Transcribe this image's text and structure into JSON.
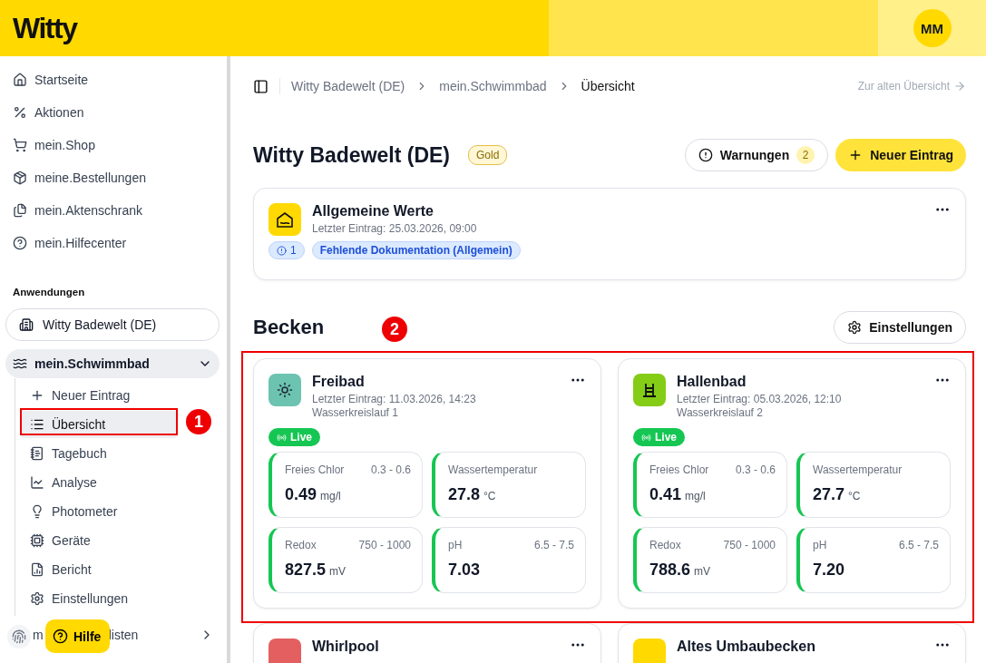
{
  "header": {
    "logo": "Witty",
    "avatar": "MM"
  },
  "sidebar": {
    "items": [
      {
        "label": "Startseite"
      },
      {
        "label": "Aktionen"
      },
      {
        "label": "mein.Shop"
      },
      {
        "label": "meine.Bestellungen"
      },
      {
        "label": "mein.Aktenschrank"
      },
      {
        "label": "mein.Hilfecenter"
      }
    ],
    "section_title": "Anwendungen",
    "app": {
      "label": "Witty Badewelt (DE)"
    },
    "group": {
      "label": "mein.Schwimmbad",
      "expanded": true,
      "children": [
        {
          "label": "Neuer Eintrag",
          "selected": false
        },
        {
          "label": "Übersicht",
          "selected": true
        },
        {
          "label": "Tagebuch",
          "selected": false
        },
        {
          "label": "Analyse",
          "selected": false
        },
        {
          "label": "Photometer",
          "selected": false
        },
        {
          "label": "Geräte",
          "selected": false
        },
        {
          "label": "Bericht",
          "selected": false
        },
        {
          "label": "Einstellungen",
          "selected": false
        }
      ]
    },
    "partial_item": {
      "parts": [
        "m",
        "listen"
      ]
    },
    "help_button": "Hilfe"
  },
  "breadcrumb": [
    "Witty Badewelt (DE)",
    "mein.Schwimmbad",
    "Übersicht"
  ],
  "old_overview_link": "Zur alten Übersicht",
  "page": {
    "title": "Witty Badewelt (DE)",
    "badge": "Gold",
    "warnings": {
      "label": "Warnungen",
      "count": "2"
    },
    "new_entry": "Neuer Eintrag"
  },
  "general_card": {
    "title": "Allgemeine Werte",
    "last_entry": "Letzter Eintrag: 25.03.2026, 09:00",
    "count": "1",
    "tag": "Fehlende Dokumentation (Allgemein)"
  },
  "pools_section": {
    "title": "Becken",
    "settings": "Einstellungen"
  },
  "pools": [
    {
      "name": "Freibad",
      "color": "#6cc3b0",
      "last_entry": "Letzter Eintrag: 11.03.2026, 14:23",
      "circuit": "Wasserkreislauf 1",
      "live": "Live",
      "metrics": [
        {
          "label": "Freies Chlor",
          "range": "0.3 - 0.6",
          "value": "0.49",
          "unit": "mg/l"
        },
        {
          "label": "Wassertemperatur",
          "value": "27.8",
          "unit": "°C"
        },
        {
          "label": "Redox",
          "range": "750 - 1000",
          "value": "827.5",
          "unit": "mV"
        },
        {
          "label": "pH",
          "range": "6.5 - 7.5",
          "value": "7.03"
        }
      ]
    },
    {
      "name": "Hallenbad",
      "color": "#84cc16",
      "last_entry": "Letzter Eintrag: 05.03.2026, 12:10",
      "circuit": "Wasserkreislauf 2",
      "live": "Live",
      "metrics": [
        {
          "label": "Freies Chlor",
          "range": "0.3 - 0.6",
          "value": "0.41",
          "unit": "mg/l"
        },
        {
          "label": "Wassertemperatur",
          "value": "27.7",
          "unit": "°C"
        },
        {
          "label": "Redox",
          "range": "750 - 1000",
          "value": "788.6",
          "unit": "mV"
        },
        {
          "label": "pH",
          "range": "6.5 - 7.5",
          "value": "7.20"
        }
      ]
    },
    {
      "name": "Whirlpool",
      "color": "#e45f5f"
    },
    {
      "name": "Altes Umbaubecken",
      "color": "#ffd900"
    }
  ],
  "annotations": [
    {
      "label": "1"
    },
    {
      "label": "2"
    }
  ]
}
